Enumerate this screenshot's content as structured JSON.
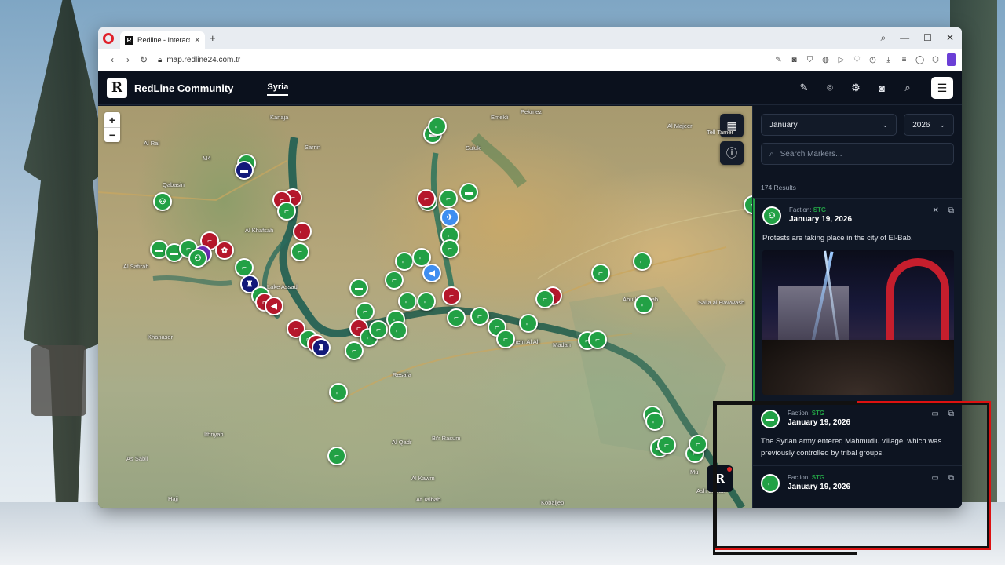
{
  "browser": {
    "tab_title": "Redline - Interactive Strat",
    "tab_favicon": "R",
    "new_tab": "+",
    "url": "map.redline24.com.tr"
  },
  "app": {
    "logo": "R",
    "name": "RedLine Community",
    "region": "Syria",
    "header_icons": [
      "pen-icon",
      "pin-icon",
      "gear-icon",
      "camera-icon",
      "search-icon",
      "menu-icon"
    ]
  },
  "map": {
    "zoom_in": "+",
    "zoom_out": "−",
    "badge": "R",
    "places": [
      {
        "name": "Kanaja"
      },
      {
        "name": "Sarrin"
      },
      {
        "name": "Emekli"
      },
      {
        "name": "Pekmez"
      },
      {
        "name": "Al Majeer"
      },
      {
        "name": "Tell Tamer"
      },
      {
        "name": "Suluk"
      },
      {
        "name": "Al Rai"
      },
      {
        "name": "Qabasin"
      },
      {
        "name": "Al Khafsah"
      },
      {
        "name": "Al Safirah"
      },
      {
        "name": "Lake Assad"
      },
      {
        "name": "Khanaser"
      },
      {
        "name": "Resafa"
      },
      {
        "name": "Ghanem Al Ali"
      },
      {
        "name": "Madan"
      },
      {
        "name": "Abu Khashab"
      },
      {
        "name": "Salia al Hawwash"
      },
      {
        "name": "Ithriyah"
      },
      {
        "name": "Al Qadr"
      },
      {
        "name": "Bi'r Rasum"
      },
      {
        "name": "As Sabil"
      },
      {
        "name": "Al Kawm"
      },
      {
        "name": "At Taibah"
      },
      {
        "name": "Kobaijep"
      },
      {
        "name": "Hajj"
      },
      {
        "name": "M4"
      },
      {
        "name": "Ash Sheeli"
      },
      {
        "name": "Mu"
      }
    ]
  },
  "panel": {
    "month": "January",
    "year": "2026",
    "search_placeholder": "Search Markers...",
    "results": "174 Results",
    "faction_label": "Faction:",
    "cards": [
      {
        "faction": "STG",
        "date": "January 19, 2026",
        "text": "Protests are taking place in the city of El-Bab.",
        "icon": "group-icon"
      },
      {
        "faction": "STG",
        "date": "January 19, 2026",
        "text": "The Syrian army entered Mahmudlu village, which was previously controlled by tribal groups.",
        "icon": "truck-icon"
      },
      {
        "faction": "STG",
        "date": "January 19, 2026",
        "text": "",
        "icon": "rifle-icon"
      }
    ]
  },
  "colors": {
    "marker_green": "#22a145",
    "marker_red": "#b5172b",
    "marker_navy": "#131a7a",
    "marker_blue": "#3f8ef0",
    "marker_purple": "#6b2bb5",
    "panel_bg": "#0d1421"
  }
}
